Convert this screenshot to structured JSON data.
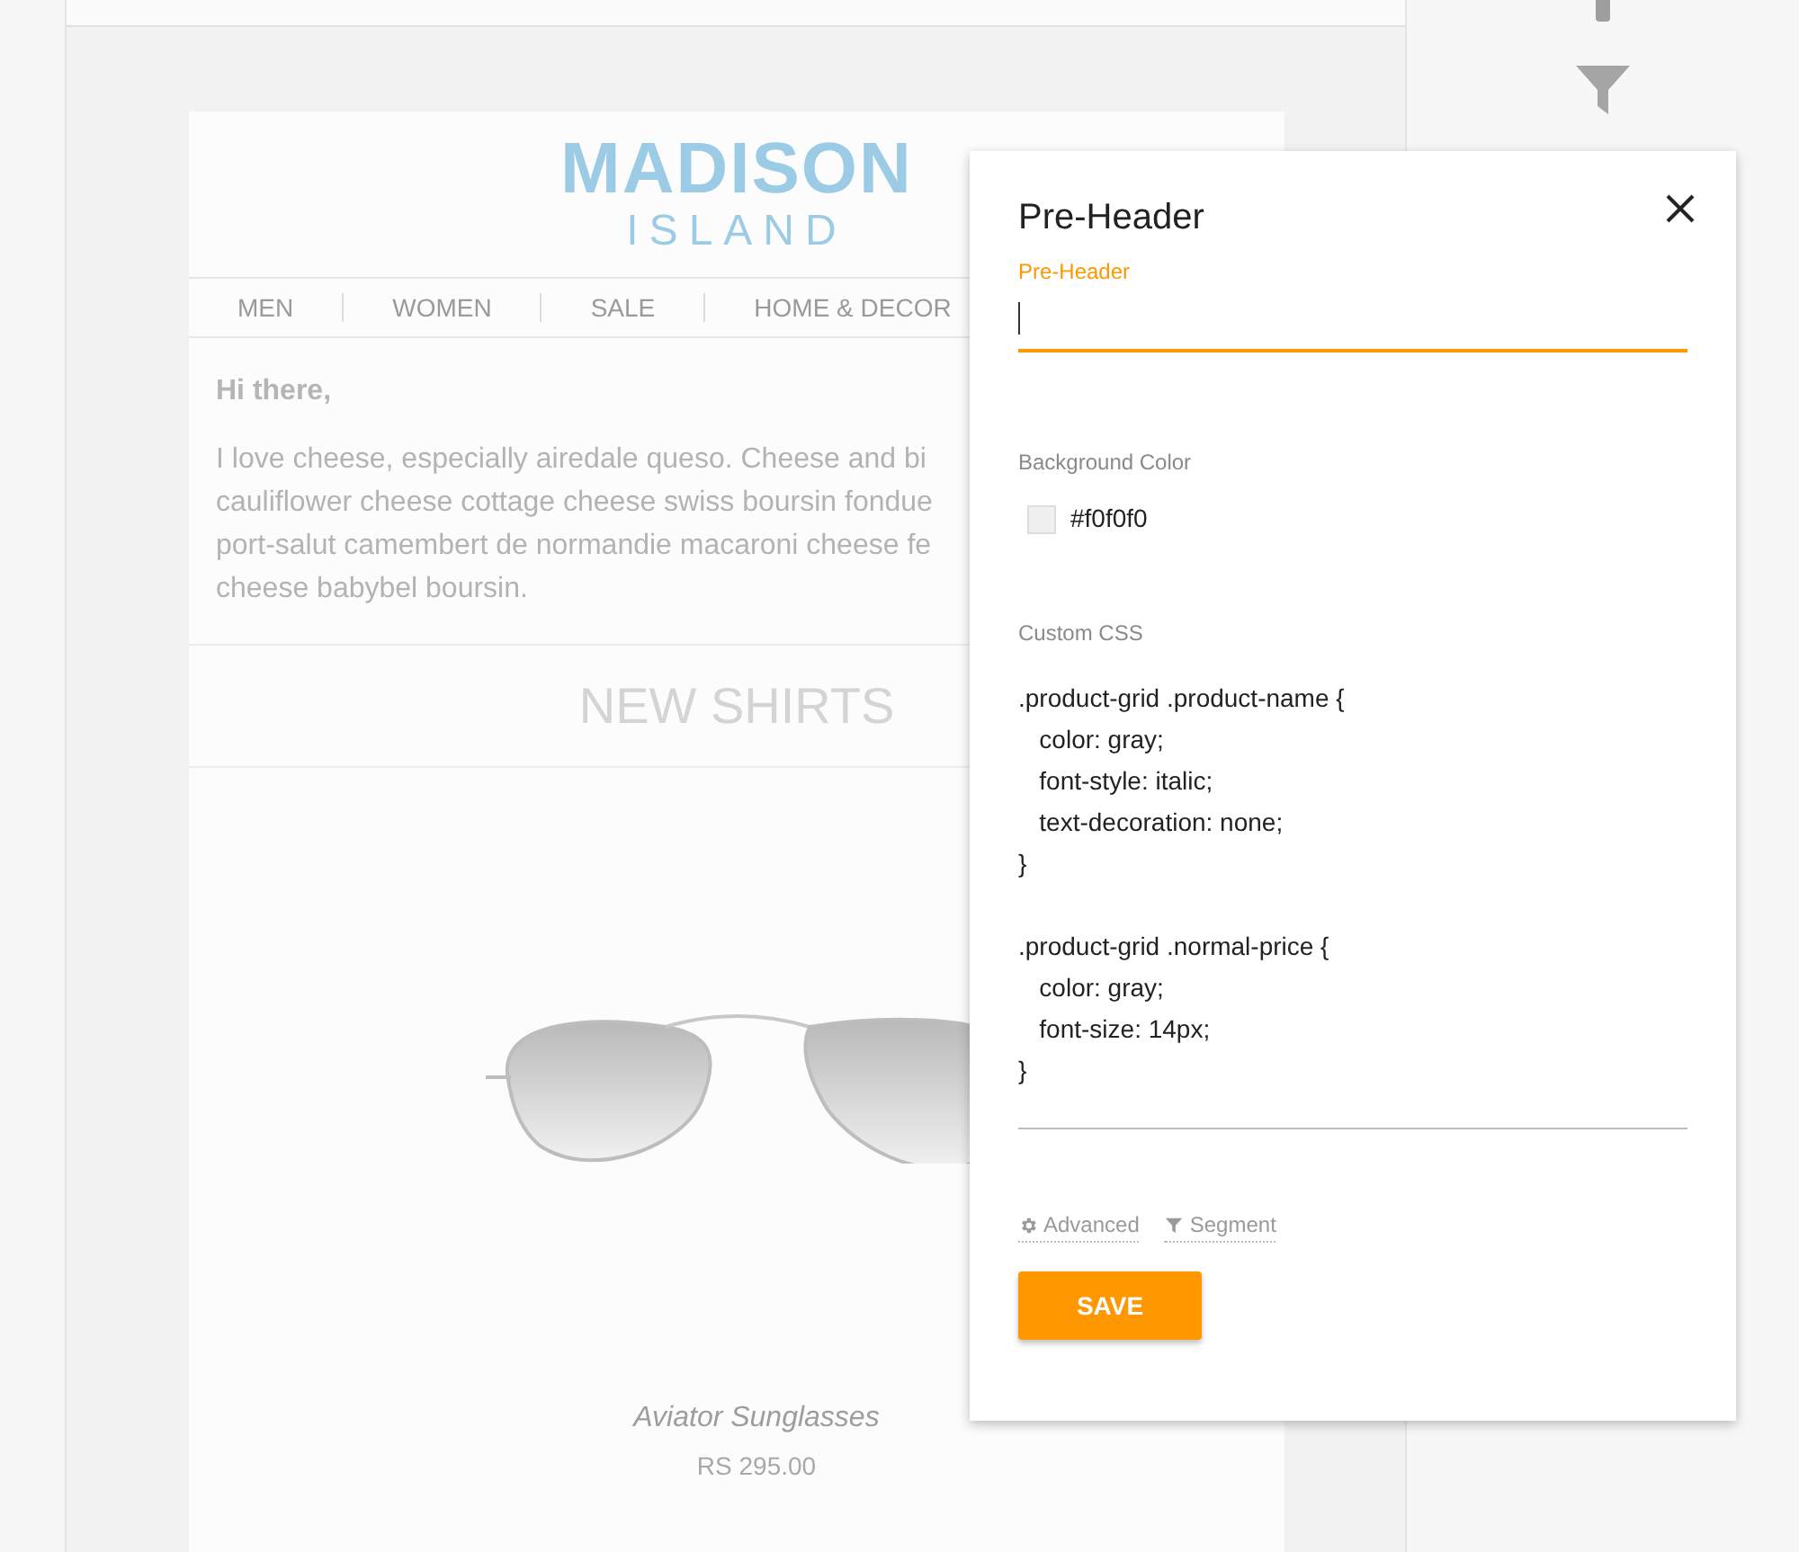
{
  "email": {
    "logo": {
      "line1": "MADISON",
      "line2": "ISLAND"
    },
    "nav": [
      "MEN",
      "WOMEN",
      "SALE",
      "HOME & DECOR"
    ],
    "greeting": "Hi there,",
    "paragraph_lines": [
      "I love cheese, especially airedale queso. Cheese and bi",
      "cauliflower cheese cottage cheese swiss boursin fondue",
      "port-salut camembert de normandie macaroni cheese fe",
      "cheese babybel boursin."
    ],
    "section_title": "NEW SHIRTS",
    "product": {
      "name": "Aviator Sunglasses",
      "price": "RS 295.00"
    }
  },
  "dialog": {
    "title": "Pre-Header",
    "preheader_field": {
      "label": "Pre-Header",
      "focused": true
    },
    "background_color": {
      "label": "Background Color",
      "value": "#f0f0f0"
    },
    "custom_css": {
      "label": "Custom CSS",
      "rules": [
        [
          ".product-grid .product-name {",
          "   color: gray;",
          "   font-style: italic;",
          "   text-decoration: none;",
          "}"
        ],
        [
          ".product-grid .normal-price {",
          "   color: gray;",
          "   font-size: 14px;",
          "}"
        ]
      ]
    },
    "links": [
      {
        "kind": "gear",
        "label": "Advanced"
      },
      {
        "kind": "funnel",
        "label": "Segment"
      }
    ],
    "save_button": "SAVE"
  }
}
